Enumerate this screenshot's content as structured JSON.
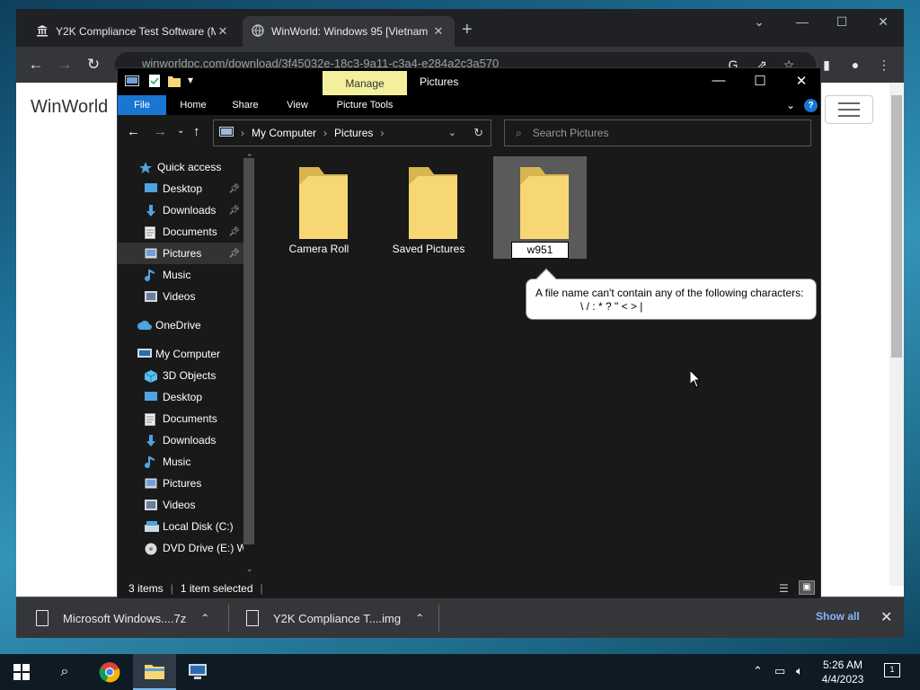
{
  "chrome": {
    "tabs": [
      {
        "title": "Y2K Compliance Test Software (M",
        "active": false
      },
      {
        "title": "WinWorld: Windows 95 [Vietnam",
        "active": true
      }
    ],
    "new_tab": "+",
    "omnibox_url": "winworldpc.com/download/3f45032e-18c3-9a11-c3a4-e284a2c3a570"
  },
  "webpage": {
    "logo": "WinWorld"
  },
  "downloads": {
    "items": [
      "Microsoft Windows....7z",
      "Y2K Compliance T....img"
    ],
    "show_all": "Show all"
  },
  "explorer": {
    "manage_tab": "Manage",
    "title": "Pictures",
    "ribbon_tabs": [
      "File",
      "Home",
      "Share",
      "View",
      "Picture Tools"
    ],
    "breadcrumb": [
      "My Computer",
      "Pictures"
    ],
    "search_placeholder": "Search Pictures",
    "nav": [
      {
        "label": "Quick access",
        "icon": "star-icon",
        "pinned": false
      },
      {
        "label": "Desktop",
        "icon": "desktop-icon",
        "pinned": true
      },
      {
        "label": "Downloads",
        "icon": "download-icon",
        "pinned": true
      },
      {
        "label": "Documents",
        "icon": "document-icon",
        "pinned": true
      },
      {
        "label": "Pictures",
        "icon": "pictures-icon",
        "pinned": true,
        "selected": true
      },
      {
        "label": "Music",
        "icon": "music-icon",
        "pinned": false
      },
      {
        "label": "Videos",
        "icon": "video-icon",
        "pinned": false
      },
      {
        "label": "OneDrive",
        "icon": "cloud-icon",
        "pinned": false
      },
      {
        "label": "My Computer",
        "icon": "computer-icon",
        "pinned": false
      },
      {
        "label": "3D Objects",
        "icon": "cube-icon",
        "pinned": false
      },
      {
        "label": "Desktop",
        "icon": "desktop-icon",
        "pinned": false
      },
      {
        "label": "Documents",
        "icon": "document-icon",
        "pinned": false
      },
      {
        "label": "Downloads",
        "icon": "download-icon",
        "pinned": false
      },
      {
        "label": "Music",
        "icon": "music-icon",
        "pinned": false
      },
      {
        "label": "Pictures",
        "icon": "pictures-icon",
        "pinned": false
      },
      {
        "label": "Videos",
        "icon": "video-icon",
        "pinned": false
      },
      {
        "label": "Local Disk (C:)",
        "icon": "drive-icon",
        "pinned": false
      },
      {
        "label": "DVD Drive (E:) W",
        "icon": "dvd-icon",
        "pinned": false
      }
    ],
    "folders": [
      {
        "name": "Camera Roll",
        "selected": false
      },
      {
        "name": "Saved Pictures",
        "selected": false
      },
      {
        "name": "w951",
        "selected": true,
        "renaming": true
      }
    ],
    "tooltip": {
      "line1": "A file name can't contain any of the following characters:",
      "line2": "\\ / : * ? \" < > |"
    },
    "status": {
      "items": "3 items",
      "selected": "1 item selected"
    }
  },
  "taskbar": {
    "time": "5:26 AM",
    "date": "4/4/2023",
    "notifications": "1"
  },
  "colors": {
    "manage_tab": "#f4ef9d",
    "file_tab": "#1976d2",
    "folder": "#f7d774",
    "accent": "#76b9ed"
  }
}
